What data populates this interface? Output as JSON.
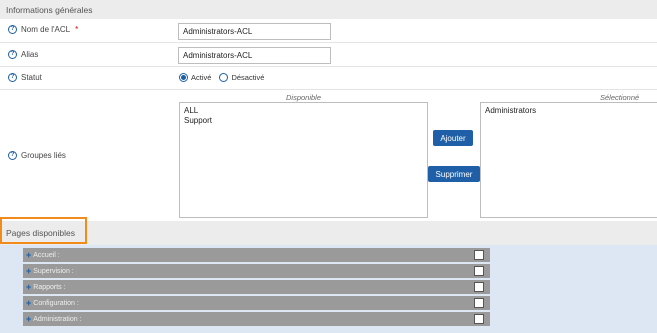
{
  "sections": {
    "general_title": "Informations générales",
    "pages_title": "Pages disponibles"
  },
  "fields": {
    "acl_name": {
      "label": "Nom de l'ACL",
      "required_mark": "*",
      "value": "Administrators-ACL"
    },
    "alias": {
      "label": "Alias",
      "value": "Administrators-ACL"
    },
    "status": {
      "label": "Statut",
      "options": [
        "Activé",
        "Désactivé"
      ],
      "selected": "Activé"
    },
    "groups": {
      "label": "Groupes liés",
      "available_title": "Disponible",
      "selected_title": "Sélectionné",
      "available": [
        "ALL",
        "Support"
      ],
      "selected": [
        "Administrators"
      ],
      "add_label": "Ajouter",
      "remove_label": "Supprimer"
    }
  },
  "tree": [
    {
      "label": "Accueil :",
      "checked": false
    },
    {
      "label": "Supervision :",
      "checked": false
    },
    {
      "label": "Rapports :",
      "checked": false
    },
    {
      "label": "Configuration :",
      "checked": false
    },
    {
      "label": "Administration :",
      "checked": false
    }
  ],
  "icons": {
    "help": "?",
    "expand": "+"
  },
  "colors": {
    "accent": "#1f5fa8",
    "highlight": "#f28a1c",
    "tree_row": "#9a9a9a"
  }
}
